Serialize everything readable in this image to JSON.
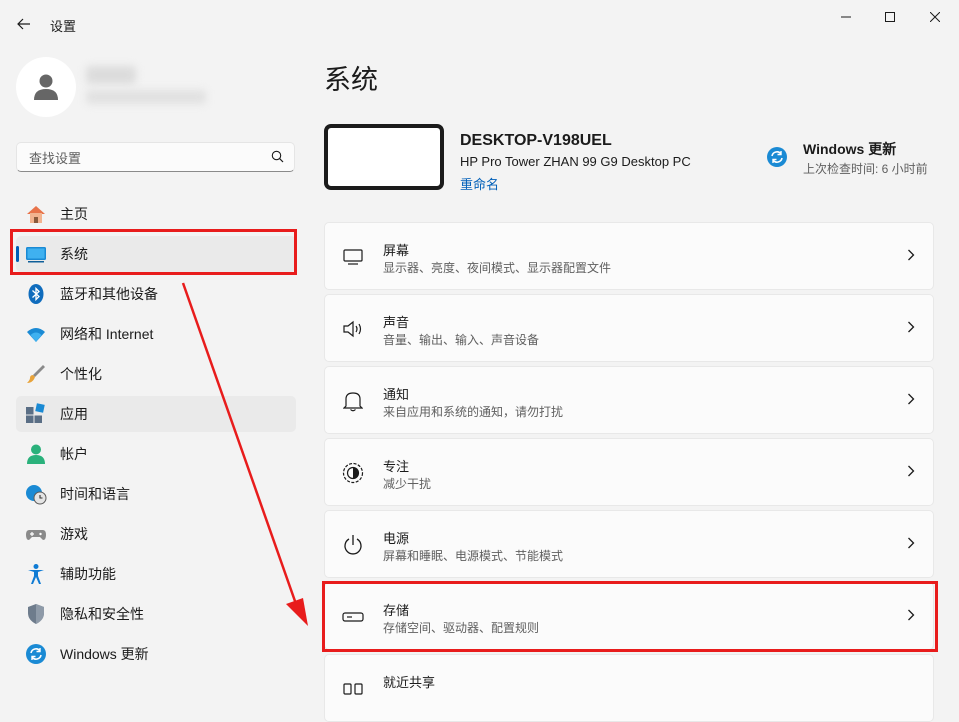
{
  "app": {
    "title": "设置"
  },
  "window_controls": {
    "minimize": "minimize-icon",
    "maximize": "maximize-icon",
    "close": "close-icon"
  },
  "search": {
    "placeholder": "查找设置"
  },
  "nav": [
    {
      "label": "主页",
      "icon": "home-icon"
    },
    {
      "label": "系统",
      "icon": "system-icon"
    },
    {
      "label": "蓝牙和其他设备",
      "icon": "bluetooth-icon"
    },
    {
      "label": "网络和 Internet",
      "icon": "wifi-icon"
    },
    {
      "label": "个性化",
      "icon": "brush-icon"
    },
    {
      "label": "应用",
      "icon": "apps-icon"
    },
    {
      "label": "帐户",
      "icon": "account-icon"
    },
    {
      "label": "时间和语言",
      "icon": "globe-clock-icon"
    },
    {
      "label": "游戏",
      "icon": "gamepad-icon"
    },
    {
      "label": "辅助功能",
      "icon": "accessibility-icon"
    },
    {
      "label": "隐私和安全性",
      "icon": "shield-icon"
    },
    {
      "label": "Windows 更新",
      "icon": "update-icon"
    }
  ],
  "main": {
    "title": "系统",
    "device": {
      "name": "DESKTOP-V198UEL",
      "model": "HP Pro Tower ZHAN 99 G9 Desktop PC",
      "rename": "重命名"
    },
    "windows_update": {
      "title": "Windows 更新",
      "subtitle": "上次检查时间: 6 小时前"
    },
    "cards": [
      {
        "title": "屏幕",
        "subtitle": "显示器、亮度、夜间模式、显示器配置文件",
        "icon": "monitor-icon"
      },
      {
        "title": "声音",
        "subtitle": "音量、输出、输入、声音设备",
        "icon": "speaker-icon"
      },
      {
        "title": "通知",
        "subtitle": "来自应用和系统的通知，请勿打扰",
        "icon": "bell-icon"
      },
      {
        "title": "专注",
        "subtitle": "减少干扰",
        "icon": "focus-icon"
      },
      {
        "title": "电源",
        "subtitle": "屏幕和睡眠、电源模式、节能模式",
        "icon": "power-icon"
      },
      {
        "title": "存储",
        "subtitle": "存储空间、驱动器、配置规则",
        "icon": "storage-icon"
      },
      {
        "title": "就近共享",
        "subtitle": "",
        "icon": "nearby-share-icon"
      }
    ]
  },
  "colors": {
    "accent": "#005fb8",
    "annotation": "#e81c1c",
    "background": "#f3f3f3"
  }
}
